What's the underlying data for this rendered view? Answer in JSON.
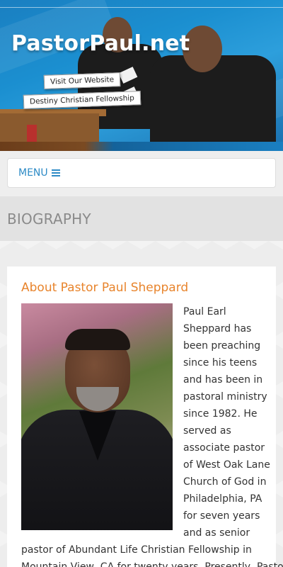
{
  "header": {
    "site_title": "PastorPaul.net",
    "visit_label": "Visit Our Website",
    "church_label": "Destiny Christian Fellowship"
  },
  "nav": {
    "menu_label": "MENU",
    "menu_icon": "hamburger-icon"
  },
  "page": {
    "title": "BIOGRAPHY"
  },
  "article": {
    "heading": "About Pastor Paul Sheppard",
    "photo_alt": "Pastor Paul Sheppard portrait",
    "bio_lines": [
      "Paul Earl",
      "Sheppard has",
      "been preaching",
      "since his teens",
      "and has been in",
      "pastoral ministry",
      "since 1982. He",
      "served as",
      "associate pastor",
      "of West Oak Lane",
      "Church of God in",
      "Philadelphia, PA",
      "for seven years",
      "and as senior"
    ],
    "bio_wide_lines": [
      "pastor of Abundant Life Christian Fellowship in",
      "Mountain View, CA for twenty years. Presently, Pastor"
    ]
  },
  "colors": {
    "accent_blue": "#2e8bc6",
    "heading_orange": "#e8842c",
    "title_gray": "#8a8a8a"
  }
}
